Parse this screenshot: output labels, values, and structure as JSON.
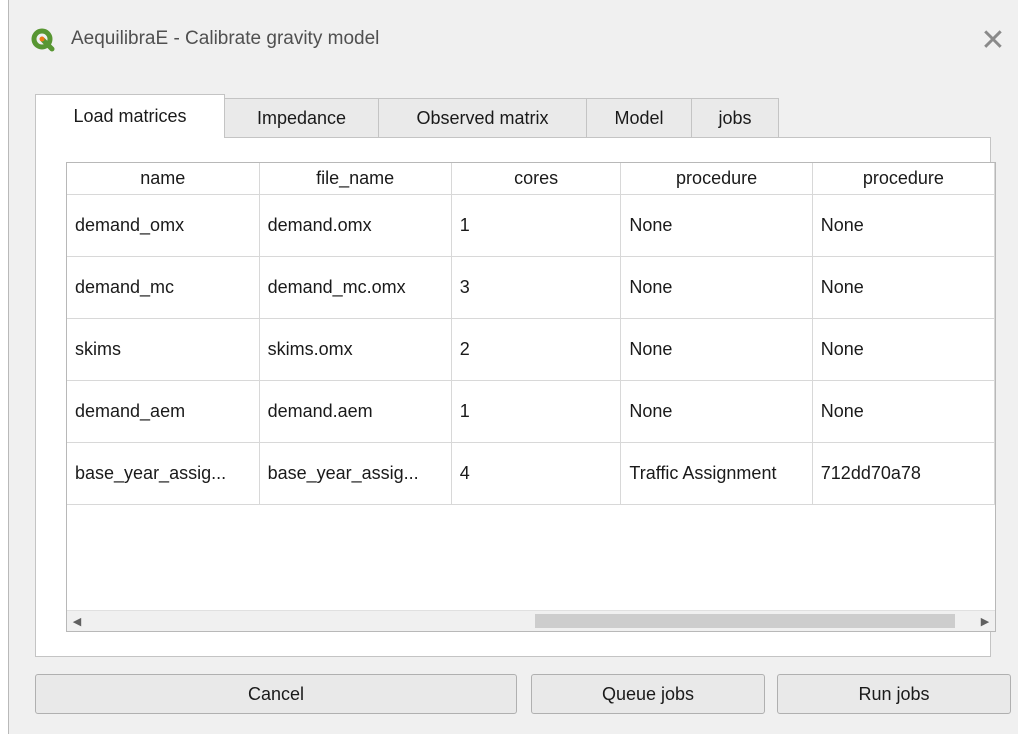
{
  "window": {
    "title": "AequilibraE - Calibrate gravity model",
    "close_glyph": "✕"
  },
  "tabs": [
    {
      "label": "Load matrices",
      "active": true
    },
    {
      "label": "Impedance",
      "active": false
    },
    {
      "label": "Observed matrix",
      "active": false
    },
    {
      "label": "Model",
      "active": false
    },
    {
      "label": "jobs",
      "active": false
    }
  ],
  "table": {
    "columns": [
      "name",
      "file_name",
      "cores",
      "procedure",
      "procedure"
    ],
    "rows": [
      [
        "demand_omx",
        "demand.omx",
        "1",
        "None",
        "None"
      ],
      [
        "demand_mc",
        "demand_mc.omx",
        "3",
        "None",
        "None"
      ],
      [
        "skims",
        "skims.omx",
        "2",
        "None",
        "None"
      ],
      [
        "demand_aem",
        "demand.aem",
        "1",
        "None",
        "None"
      ],
      [
        "base_year_assig...",
        "base_year_assig...",
        "4",
        "Traffic Assignment",
        "712dd70a78"
      ]
    ]
  },
  "scrollbar": {
    "left_arrow": "◀",
    "right_arrow": "▶"
  },
  "buttons": {
    "cancel": "Cancel",
    "queue": "Queue jobs",
    "run": "Run jobs"
  },
  "colors": {
    "qgis_green": "#589632",
    "qgis_yellow": "#ee7913"
  },
  "icons": {
    "app": "qgis-logo-icon",
    "close": "close-icon"
  }
}
